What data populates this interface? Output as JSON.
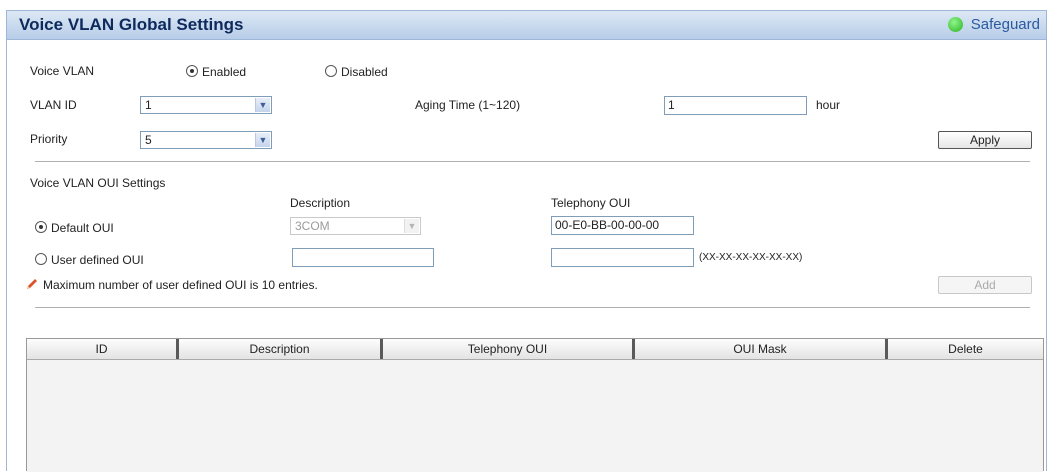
{
  "header": {
    "title": "Voice VLAN Global Settings",
    "safeguard": "Safeguard"
  },
  "voice_vlan": {
    "label": "Voice VLAN",
    "enabled_label": "Enabled",
    "disabled_label": "Disabled",
    "selected": "Enabled"
  },
  "vlan_id": {
    "label": "VLAN ID",
    "value": "1"
  },
  "aging_time": {
    "label": "Aging Time (1~120)",
    "value": "1",
    "unit": "hour"
  },
  "priority": {
    "label": "Priority",
    "value": "5"
  },
  "apply_label": "Apply",
  "oui": {
    "section_label": "Voice VLAN OUI Settings",
    "description_header": "Description",
    "telephony_header": "Telephony OUI",
    "default_label": "Default OUI",
    "default_description": "3COM",
    "default_telephony": "00-E0-BB-00-00-00",
    "user_label": "User defined OUI",
    "user_description": "",
    "user_telephony": "",
    "format_hint": "(XX-XX-XX-XX-XX-XX)",
    "selected": "Default OUI"
  },
  "note": "Maximum number of user defined OUI is 10 entries.",
  "add_label": "Add",
  "table": {
    "columns": [
      "ID",
      "Description",
      "Telephony OUI",
      "OUI Mask",
      "Delete"
    ],
    "rows": []
  }
}
